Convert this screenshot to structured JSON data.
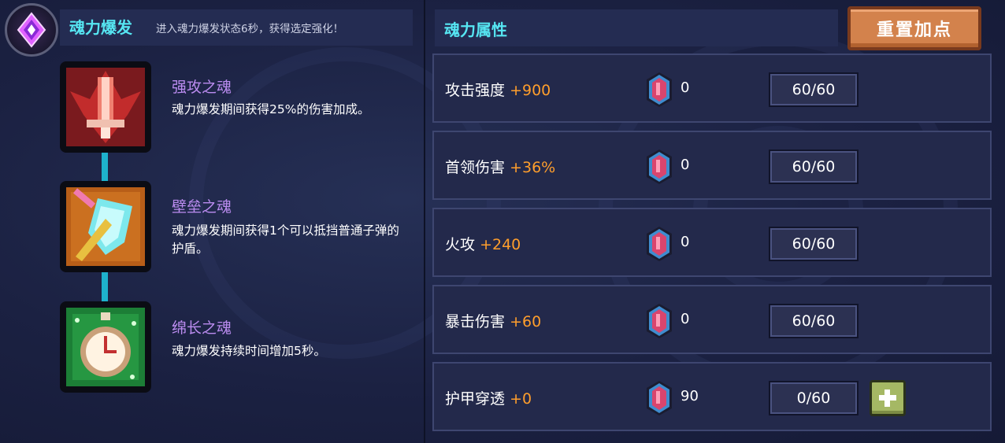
{
  "left": {
    "title": "魂力爆发",
    "description": "进入魂力爆发状态6秒，获得选定强化！",
    "skills": [
      {
        "name": "强攻之魂",
        "desc": "魂力爆发期间获得25%的伤害加成。",
        "icon": "red-sword-icon"
      },
      {
        "name": "壁垒之魂",
        "desc": "魂力爆发期间获得1个可以抵挡普通子弹的护盾。",
        "icon": "shield-icon"
      },
      {
        "name": "绵长之魂",
        "desc": "魂力爆发持续时间增加5秒。",
        "icon": "stopwatch-icon"
      }
    ]
  },
  "right": {
    "title": "魂力属性",
    "reset_label": "重置加点",
    "rows": [
      {
        "label": "攻击强度",
        "bonus": "+900",
        "gems": "0",
        "level": "60/60"
      },
      {
        "label": "首领伤害",
        "bonus": "+36%",
        "gems": "0",
        "level": "60/60"
      },
      {
        "label": "火攻",
        "bonus": "+240",
        "gems": "0",
        "level": "60/60"
      },
      {
        "label": "暴击伤害",
        "bonus": "+60",
        "gems": "0",
        "level": "60/60"
      },
      {
        "label": "护甲穿透",
        "bonus": "+0",
        "gems": "90",
        "level": "0/60"
      }
    ]
  },
  "colors": {
    "accent_cyan": "#56e6f2",
    "bonus_orange": "#ff9e2c",
    "skill_purple": "#bb8cf0",
    "reset_orange": "#d3824c"
  }
}
